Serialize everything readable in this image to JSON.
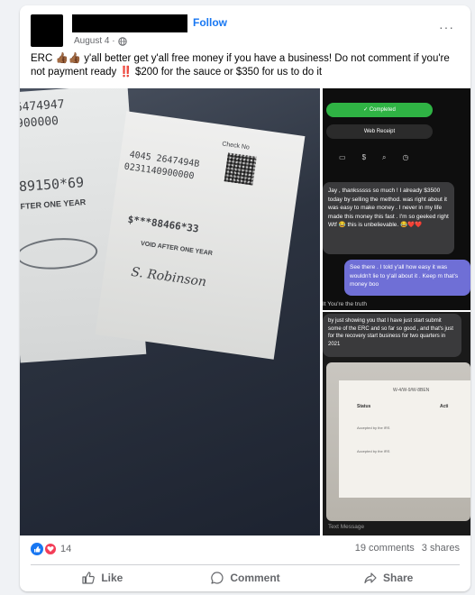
{
  "post": {
    "follow_label": "Follow",
    "date": "August 4 ·",
    "more_label": "···",
    "text": "ERC 👍🏾👍🏾 y'all better get y'all free money if you have a business! Do not comment if you're not payment ready ‼️ $200 for the sauce or $350 for us to do it"
  },
  "images": {
    "main": {
      "check1_num1": "6474947",
      "check1_num2": "900000",
      "check1_num3": "89150*69",
      "check1_void": "FTER ONE YEAR",
      "check2_label": "Check No",
      "check2_num1": "4045 2647494B",
      "check2_num2": "0231140900000",
      "check2_amount": "$***88466*33",
      "check2_void": "VOID AFTER ONE YEAR",
      "check2_sig": "S. Robinson"
    },
    "top_right": {
      "completed": "✓  Completed",
      "receipt": "Web Receipt",
      "bubble1": "Jay , thanksssss so much ! I already $3500 today by selling the method. was right about it was easy to make money . I never in my life made this money this fast . I'm so geeked right Wtf 😂 this is unbelievable. 😂❤️❤️",
      "bubble2": "See there . I told y'all how easy it was wouldn't lie to y'all about it . Keep m that's money boo",
      "bubble3": "It  You're the truth"
    },
    "bottom_right": {
      "bubble": "by just showing you that I have just start submit some of the ERC and so far so good , and that's just for the recovery start business for two quarters in 2021",
      "sheet_title": "W-4/W-9/W-8BEN",
      "col1": "Status",
      "col2": "Acti",
      "row1": "Accepted by the IRS",
      "row2": "Accepted by the IRS",
      "input_placeholder": "Text Message"
    }
  },
  "engagement": {
    "reaction_count": "14",
    "comments": "19 comments",
    "shares": "3 shares"
  },
  "actions": {
    "like": "Like",
    "comment": "Comment",
    "share": "Share"
  },
  "colors": {
    "accent": "#1877f2",
    "love": "#f33e58",
    "text_secondary": "#65676b"
  }
}
